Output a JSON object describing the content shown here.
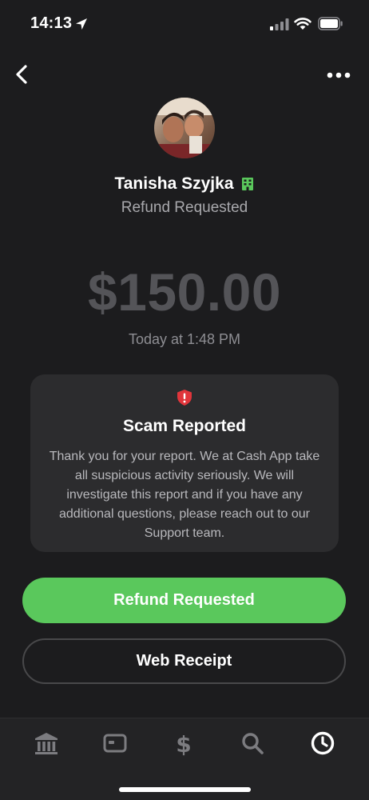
{
  "status_bar": {
    "time": "14:13"
  },
  "profile": {
    "name": "Tanisha Szyjka",
    "subtitle": "Refund Requested"
  },
  "payment": {
    "amount": "$150.00",
    "timestamp": "Today at 1:48 PM"
  },
  "scam_card": {
    "title": "Scam Reported",
    "body": "Thank you for your report. We at Cash App take all suspicious activity seriously. We will investigate this report and if you have any additional questions, please reach out to our Support team."
  },
  "actions": {
    "primary_label": "Refund Requested",
    "secondary_label": "Web Receipt"
  },
  "tabs": [
    {
      "icon": "bank-icon",
      "active": false
    },
    {
      "icon": "card-icon",
      "active": false
    },
    {
      "icon": "dollar-icon",
      "active": false
    },
    {
      "icon": "search-icon",
      "active": false
    },
    {
      "icon": "clock-icon",
      "active": true
    }
  ],
  "colors": {
    "background": "#1c1c1e",
    "card": "#2c2c2e",
    "accent_green": "#5ac85c",
    "alert_red": "#e0353b",
    "business_badge": "#5ac85c"
  }
}
